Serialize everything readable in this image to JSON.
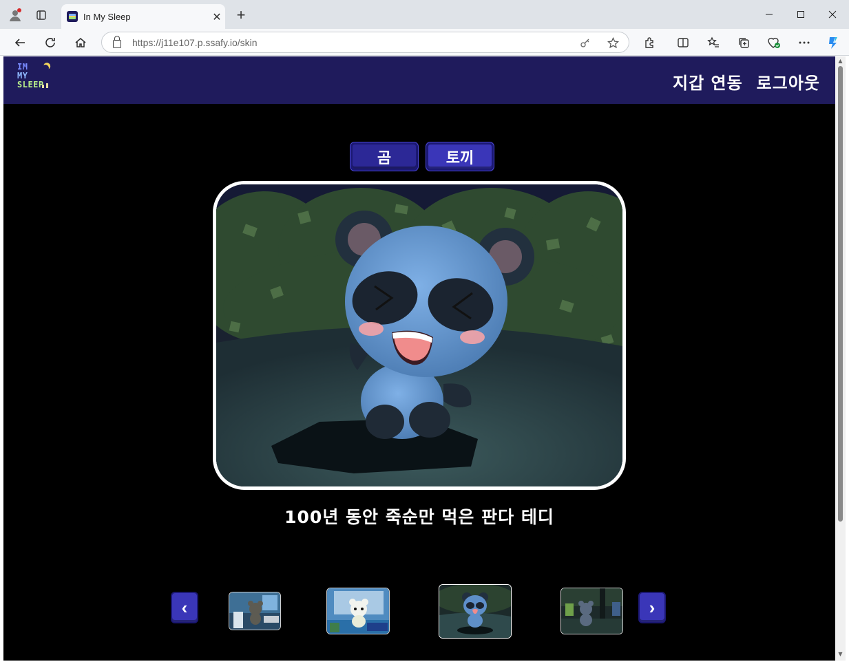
{
  "browser": {
    "tab_title": "In My Sleep",
    "url_host": "https://j11e107.p.ssafy.io",
    "url_path": "/skin",
    "new_tab_label": "+",
    "close_tab_label": "✕"
  },
  "site": {
    "logo_lines": [
      "IM",
      "MY",
      "SLEEP"
    ],
    "nav": [
      {
        "label": "지갑 연동"
      },
      {
        "label": "로그아웃"
      }
    ]
  },
  "skin_types": [
    {
      "label": "곰",
      "active": true
    },
    {
      "label": "토끼",
      "active": false
    }
  ],
  "selected_skin": {
    "caption": "100년 동안 죽순만 먹은 판다 테디"
  },
  "carousel": {
    "prev_label": "‹",
    "next_label": "›",
    "thumbnails": [
      {
        "name": "bear-in-bedroom",
        "selected": false
      },
      {
        "name": "white-bear-in-room",
        "selected": false
      },
      {
        "name": "panda-in-forest",
        "selected": true
      },
      {
        "name": "bear-in-dark-forest",
        "selected": false
      }
    ]
  },
  "colors": {
    "header_bg": "#1f1b5c",
    "button_bg": "#3a36b8",
    "page_bg": "#000000",
    "frame_border": "#ffffff"
  }
}
